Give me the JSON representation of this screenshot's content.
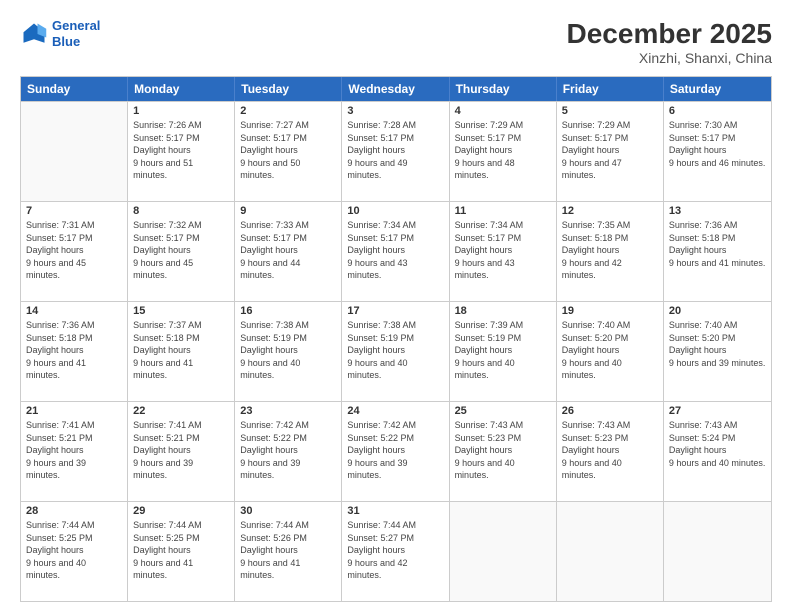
{
  "header": {
    "logo_line1": "General",
    "logo_line2": "Blue",
    "month": "December 2025",
    "location": "Xinzhi, Shanxi, China"
  },
  "days_of_week": [
    "Sunday",
    "Monday",
    "Tuesday",
    "Wednesday",
    "Thursday",
    "Friday",
    "Saturday"
  ],
  "weeks": [
    [
      {
        "day": "",
        "sunrise": "",
        "sunset": "",
        "daylight": ""
      },
      {
        "day": "1",
        "sunrise": "Sunrise: 7:26 AM",
        "sunset": "Sunset: 5:17 PM",
        "daylight": "Daylight: 9 hours and 51 minutes."
      },
      {
        "day": "2",
        "sunrise": "Sunrise: 7:27 AM",
        "sunset": "Sunset: 5:17 PM",
        "daylight": "Daylight: 9 hours and 50 minutes."
      },
      {
        "day": "3",
        "sunrise": "Sunrise: 7:28 AM",
        "sunset": "Sunset: 5:17 PM",
        "daylight": "Daylight: 9 hours and 49 minutes."
      },
      {
        "day": "4",
        "sunrise": "Sunrise: 7:29 AM",
        "sunset": "Sunset: 5:17 PM",
        "daylight": "Daylight: 9 hours and 48 minutes."
      },
      {
        "day": "5",
        "sunrise": "Sunrise: 7:29 AM",
        "sunset": "Sunset: 5:17 PM",
        "daylight": "Daylight: 9 hours and 47 minutes."
      },
      {
        "day": "6",
        "sunrise": "Sunrise: 7:30 AM",
        "sunset": "Sunset: 5:17 PM",
        "daylight": "Daylight: 9 hours and 46 minutes."
      }
    ],
    [
      {
        "day": "7",
        "sunrise": "Sunrise: 7:31 AM",
        "sunset": "Sunset: 5:17 PM",
        "daylight": "Daylight: 9 hours and 45 minutes."
      },
      {
        "day": "8",
        "sunrise": "Sunrise: 7:32 AM",
        "sunset": "Sunset: 5:17 PM",
        "daylight": "Daylight: 9 hours and 45 minutes."
      },
      {
        "day": "9",
        "sunrise": "Sunrise: 7:33 AM",
        "sunset": "Sunset: 5:17 PM",
        "daylight": "Daylight: 9 hours and 44 minutes."
      },
      {
        "day": "10",
        "sunrise": "Sunrise: 7:34 AM",
        "sunset": "Sunset: 5:17 PM",
        "daylight": "Daylight: 9 hours and 43 minutes."
      },
      {
        "day": "11",
        "sunrise": "Sunrise: 7:34 AM",
        "sunset": "Sunset: 5:17 PM",
        "daylight": "Daylight: 9 hours and 43 minutes."
      },
      {
        "day": "12",
        "sunrise": "Sunrise: 7:35 AM",
        "sunset": "Sunset: 5:18 PM",
        "daylight": "Daylight: 9 hours and 42 minutes."
      },
      {
        "day": "13",
        "sunrise": "Sunrise: 7:36 AM",
        "sunset": "Sunset: 5:18 PM",
        "daylight": "Daylight: 9 hours and 41 minutes."
      }
    ],
    [
      {
        "day": "14",
        "sunrise": "Sunrise: 7:36 AM",
        "sunset": "Sunset: 5:18 PM",
        "daylight": "Daylight: 9 hours and 41 minutes."
      },
      {
        "day": "15",
        "sunrise": "Sunrise: 7:37 AM",
        "sunset": "Sunset: 5:18 PM",
        "daylight": "Daylight: 9 hours and 41 minutes."
      },
      {
        "day": "16",
        "sunrise": "Sunrise: 7:38 AM",
        "sunset": "Sunset: 5:19 PM",
        "daylight": "Daylight: 9 hours and 40 minutes."
      },
      {
        "day": "17",
        "sunrise": "Sunrise: 7:38 AM",
        "sunset": "Sunset: 5:19 PM",
        "daylight": "Daylight: 9 hours and 40 minutes."
      },
      {
        "day": "18",
        "sunrise": "Sunrise: 7:39 AM",
        "sunset": "Sunset: 5:19 PM",
        "daylight": "Daylight: 9 hours and 40 minutes."
      },
      {
        "day": "19",
        "sunrise": "Sunrise: 7:40 AM",
        "sunset": "Sunset: 5:20 PM",
        "daylight": "Daylight: 9 hours and 40 minutes."
      },
      {
        "day": "20",
        "sunrise": "Sunrise: 7:40 AM",
        "sunset": "Sunset: 5:20 PM",
        "daylight": "Daylight: 9 hours and 39 minutes."
      }
    ],
    [
      {
        "day": "21",
        "sunrise": "Sunrise: 7:41 AM",
        "sunset": "Sunset: 5:21 PM",
        "daylight": "Daylight: 9 hours and 39 minutes."
      },
      {
        "day": "22",
        "sunrise": "Sunrise: 7:41 AM",
        "sunset": "Sunset: 5:21 PM",
        "daylight": "Daylight: 9 hours and 39 minutes."
      },
      {
        "day": "23",
        "sunrise": "Sunrise: 7:42 AM",
        "sunset": "Sunset: 5:22 PM",
        "daylight": "Daylight: 9 hours and 39 minutes."
      },
      {
        "day": "24",
        "sunrise": "Sunrise: 7:42 AM",
        "sunset": "Sunset: 5:22 PM",
        "daylight": "Daylight: 9 hours and 39 minutes."
      },
      {
        "day": "25",
        "sunrise": "Sunrise: 7:43 AM",
        "sunset": "Sunset: 5:23 PM",
        "daylight": "Daylight: 9 hours and 40 minutes."
      },
      {
        "day": "26",
        "sunrise": "Sunrise: 7:43 AM",
        "sunset": "Sunset: 5:23 PM",
        "daylight": "Daylight: 9 hours and 40 minutes."
      },
      {
        "day": "27",
        "sunrise": "Sunrise: 7:43 AM",
        "sunset": "Sunset: 5:24 PM",
        "daylight": "Daylight: 9 hours and 40 minutes."
      }
    ],
    [
      {
        "day": "28",
        "sunrise": "Sunrise: 7:44 AM",
        "sunset": "Sunset: 5:25 PM",
        "daylight": "Daylight: 9 hours and 40 minutes."
      },
      {
        "day": "29",
        "sunrise": "Sunrise: 7:44 AM",
        "sunset": "Sunset: 5:25 PM",
        "daylight": "Daylight: 9 hours and 41 minutes."
      },
      {
        "day": "30",
        "sunrise": "Sunrise: 7:44 AM",
        "sunset": "Sunset: 5:26 PM",
        "daylight": "Daylight: 9 hours and 41 minutes."
      },
      {
        "day": "31",
        "sunrise": "Sunrise: 7:44 AM",
        "sunset": "Sunset: 5:27 PM",
        "daylight": "Daylight: 9 hours and 42 minutes."
      },
      {
        "day": "",
        "sunrise": "",
        "sunset": "",
        "daylight": ""
      },
      {
        "day": "",
        "sunrise": "",
        "sunset": "",
        "daylight": ""
      },
      {
        "day": "",
        "sunrise": "",
        "sunset": "",
        "daylight": ""
      }
    ]
  ]
}
